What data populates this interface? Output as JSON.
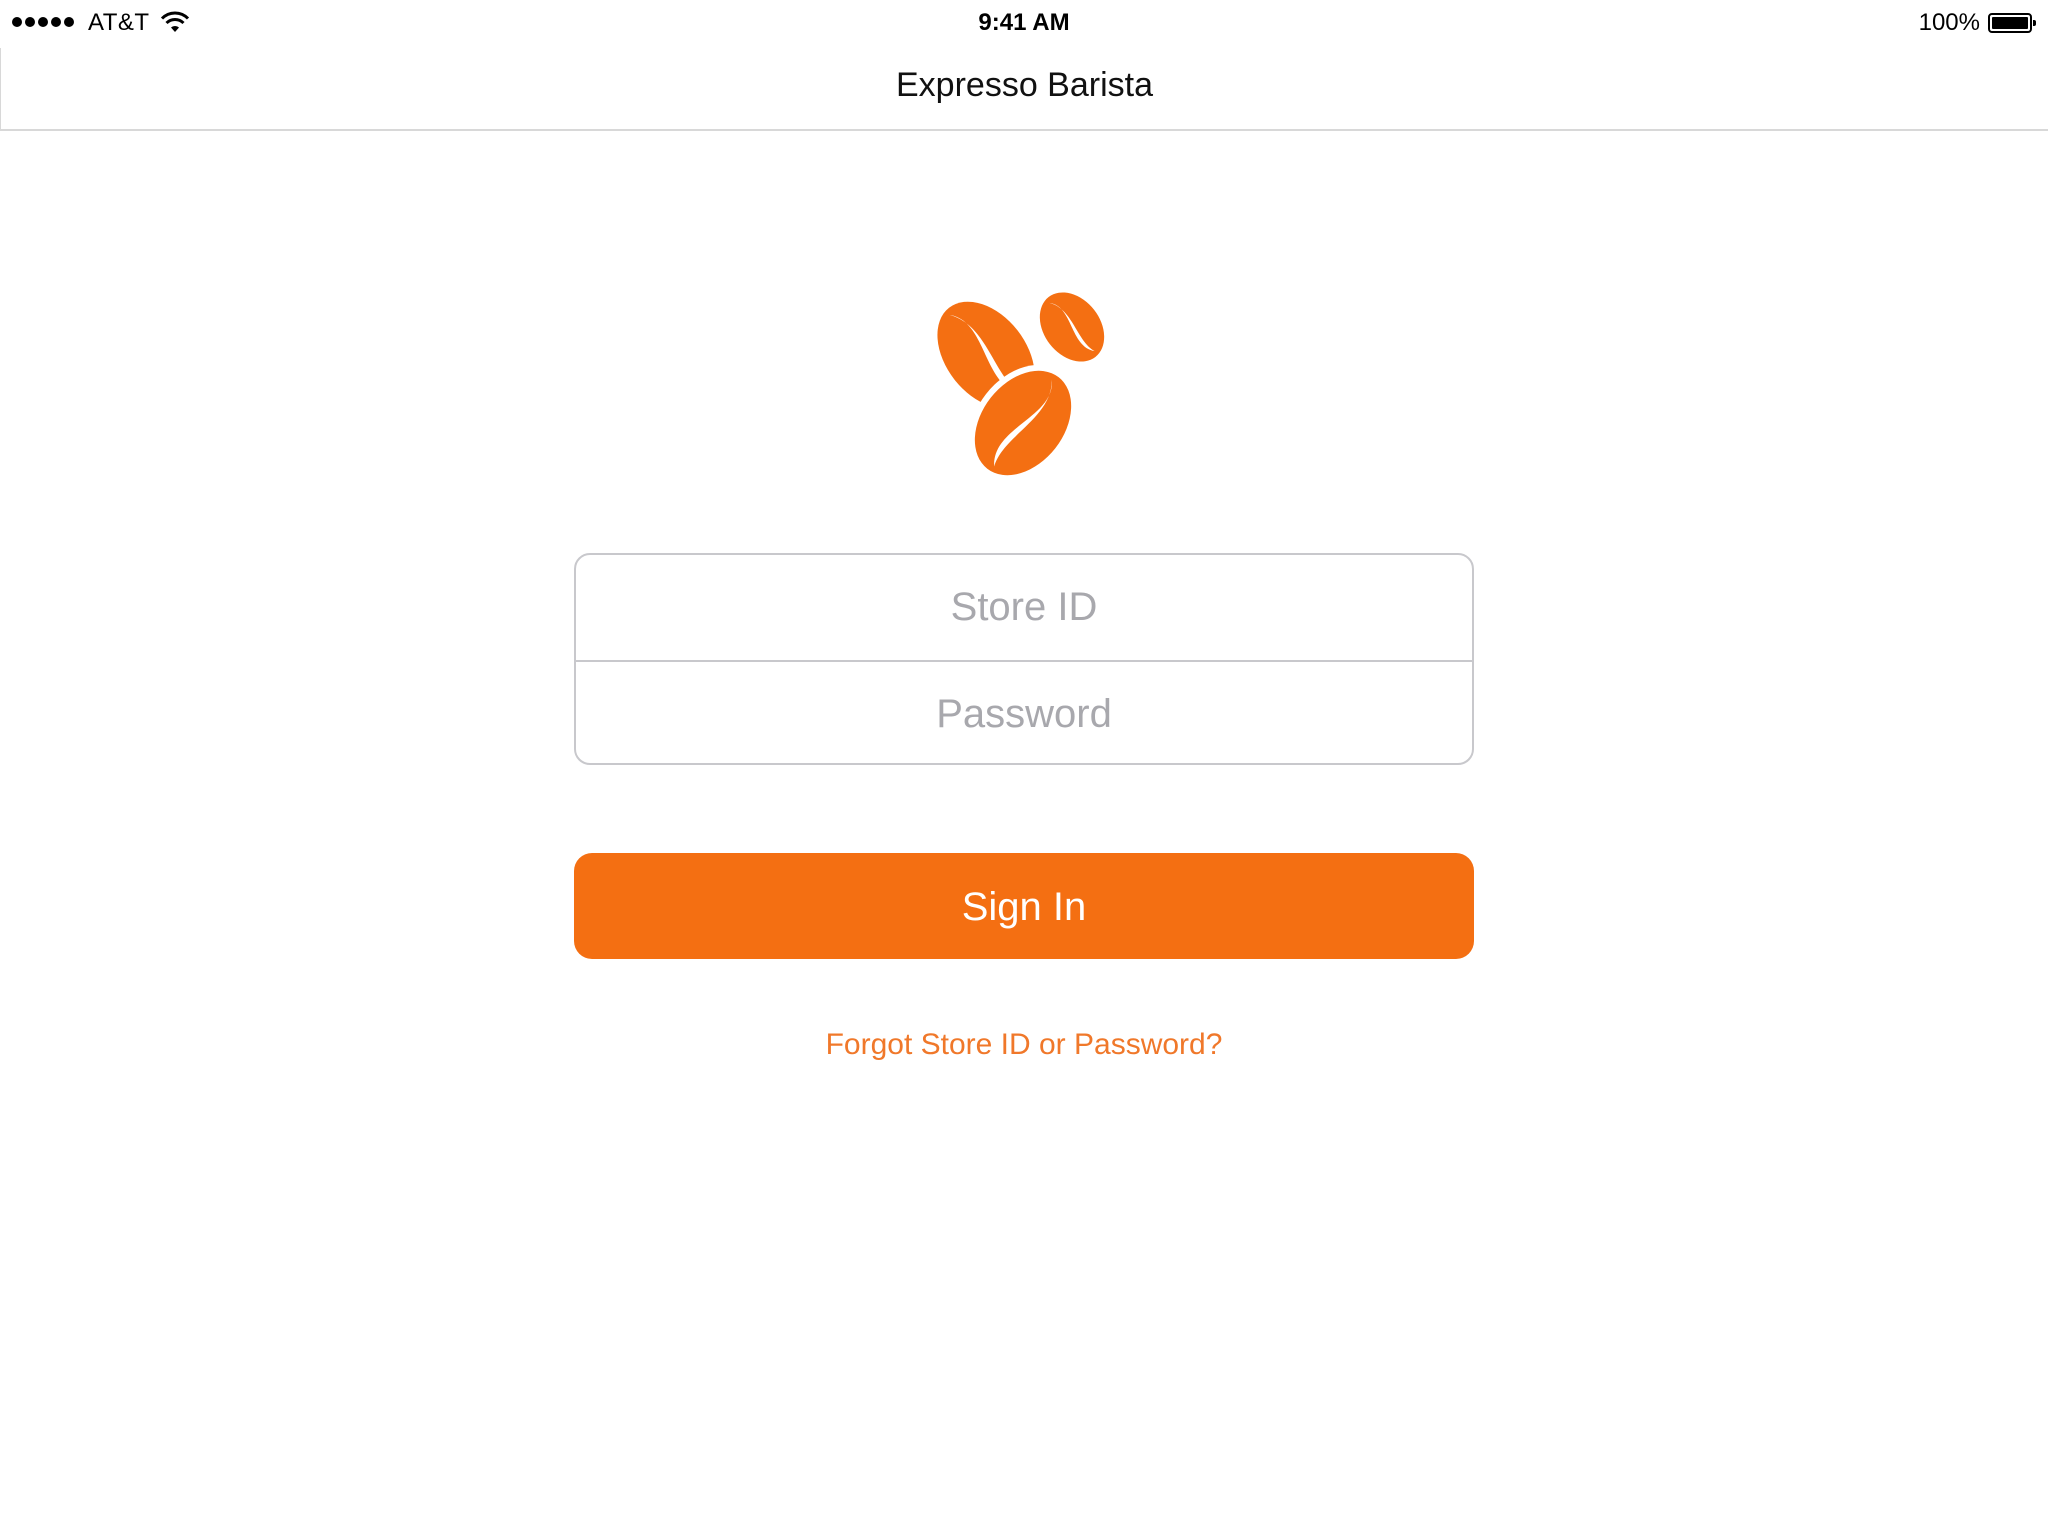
{
  "status_bar": {
    "carrier": "AT&T",
    "time": "9:41 AM",
    "battery_percent_label": "100%",
    "battery_level": 1.0,
    "signal_bars": 5
  },
  "nav": {
    "title": "Expresso Barista"
  },
  "logo": {
    "icon": "coffee-beans-icon",
    "color": "#f46f12"
  },
  "form": {
    "store_id": {
      "value": "",
      "placeholder": "Store ID"
    },
    "password": {
      "value": "",
      "placeholder": "Password"
    },
    "sign_in_label": "Sign In",
    "forgot_label": "Forgot Store ID or Password?"
  },
  "colors": {
    "accent": "#f46f12",
    "link": "#f0782a",
    "border": "#c8c8cc",
    "placeholder": "#a8a8ad"
  }
}
